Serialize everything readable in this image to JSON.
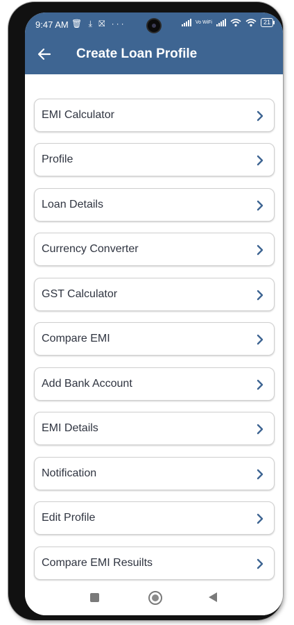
{
  "status": {
    "time": "9:47 AM",
    "left_icons": "🗑 ⤓ ⛝ ···",
    "vowifi": "Vo WiFi",
    "battery": "21"
  },
  "appbar": {
    "title": "Create Loan Profile"
  },
  "menu": [
    {
      "label": "EMI Calculator"
    },
    {
      "label": "Profile"
    },
    {
      "label": "Loan Details"
    },
    {
      "label": "Currency Converter"
    },
    {
      "label": "GST Calculator"
    },
    {
      "label": "Compare EMI"
    },
    {
      "label": "Add Bank Account"
    },
    {
      "label": "EMI Details"
    },
    {
      "label": "Notification"
    },
    {
      "label": "Edit Profile"
    },
    {
      "label": "Compare EMI Resuilts"
    },
    {
      "label": ""
    }
  ],
  "colors": {
    "primary": "#3e6592",
    "text": "#2f3440",
    "border": "#cfcfcf"
  }
}
